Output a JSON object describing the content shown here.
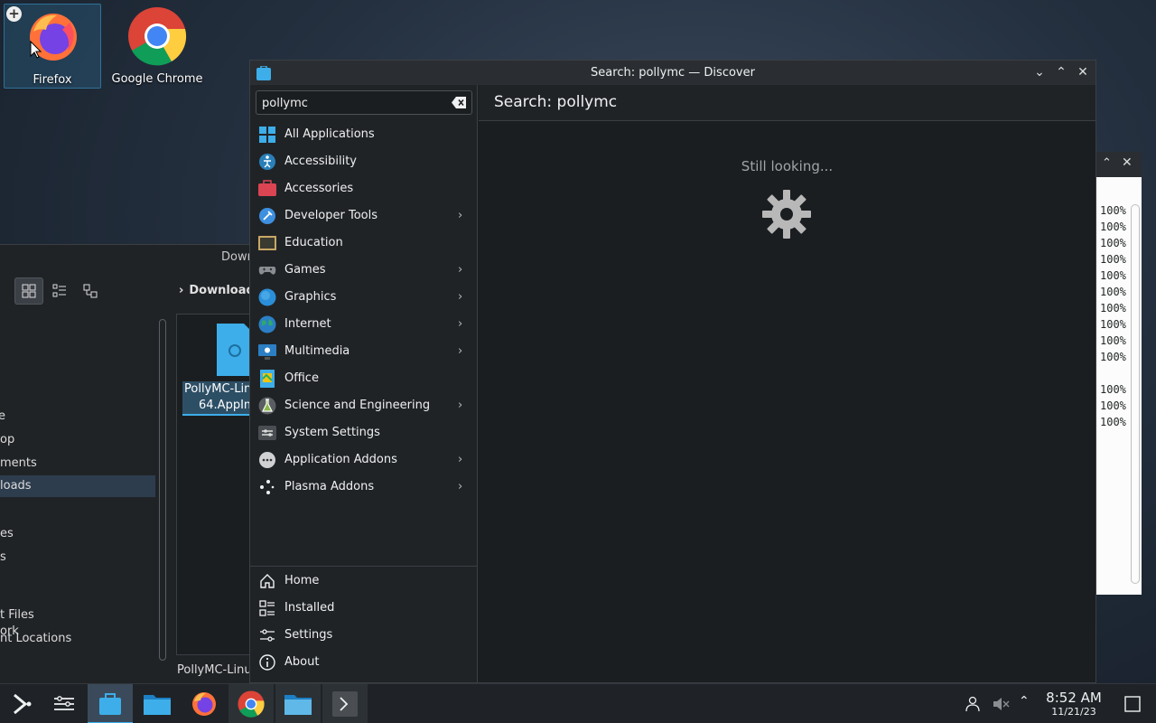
{
  "desktop": {
    "icons": [
      {
        "label": "Firefox",
        "icon": "firefox-icon"
      },
      {
        "label": "Google Chrome",
        "icon": "chrome-icon"
      }
    ]
  },
  "file_manager": {
    "title_partial": "Down",
    "breadcrumb_partial": "Download",
    "places": [
      "e",
      "op",
      "ments",
      "loads",
      "es",
      "s",
      "ork",
      "t Files",
      "nt Locations"
    ],
    "active_place_index": 3,
    "file_label_line1": "PollyMC-Linu",
    "file_label_line2": "64.AppIm",
    "status_partial": "PollyMC-Linu"
  },
  "terminal": {
    "lines": [
      "100%",
      "100%",
      "100%",
      "100%",
      "100%",
      "100%",
      "100%",
      "100%",
      "100%",
      "100%",
      "",
      "100%",
      "100%",
      "100%"
    ]
  },
  "discover": {
    "window_title": "Search: pollymc — Discover",
    "search_value": "pollymc",
    "page_heading": "Search: pollymc",
    "status_text": "Still looking...",
    "categories": [
      {
        "label": "All Applications",
        "icon": "all-apps-icon",
        "color": "#3daee9",
        "has_children": false
      },
      {
        "label": "Accessibility",
        "icon": "accessibility-icon",
        "color": "#2980b9",
        "has_children": false
      },
      {
        "label": "Accessories",
        "icon": "accessories-icon",
        "color": "#da4453",
        "has_children": false
      },
      {
        "label": "Developer Tools",
        "icon": "developer-tools-icon",
        "color": "#3d8fe0",
        "has_children": true
      },
      {
        "label": "Education",
        "icon": "education-icon",
        "color": "#5a5040",
        "has_children": false
      },
      {
        "label": "Games",
        "icon": "games-icon",
        "color": "#8a8e92",
        "has_children": true
      },
      {
        "label": "Graphics",
        "icon": "graphics-icon",
        "color": "#2a8fd8",
        "has_children": true
      },
      {
        "label": "Internet",
        "icon": "internet-icon",
        "color": "#2fa86f",
        "has_children": true
      },
      {
        "label": "Multimedia",
        "icon": "multimedia-icon",
        "color": "#2c7fc4",
        "has_children": true
      },
      {
        "label": "Office",
        "icon": "office-icon",
        "color": "#3daee9",
        "has_children": false
      },
      {
        "label": "Science and Engineering",
        "icon": "science-icon",
        "color": "#8ab84a",
        "has_children": true
      },
      {
        "label": "System Settings",
        "icon": "system-settings-icon",
        "color": "#6a6e72",
        "has_children": false
      },
      {
        "label": "Application Addons",
        "icon": "app-addons-icon",
        "color": "#9a9ea2",
        "has_children": true
      },
      {
        "label": "Plasma Addons",
        "icon": "plasma-addons-icon",
        "color": "#cfd1d3",
        "has_children": true
      }
    ],
    "nav": [
      {
        "label": "Home",
        "icon": "home-icon"
      },
      {
        "label": "Installed",
        "icon": "installed-icon"
      },
      {
        "label": "Settings",
        "icon": "settings-icon"
      },
      {
        "label": "About",
        "icon": "about-icon"
      }
    ]
  },
  "taskbar": {
    "items": [
      "application-launcher-icon",
      "task-manager-icon",
      "discover-icon",
      "file-manager-icon",
      "firefox-icon",
      "chrome-icon",
      "dolphin-icon",
      "konsole-icon"
    ],
    "time": "8:52 AM",
    "date": "11/21/23"
  },
  "colors": {
    "accent": "#3daee9",
    "window_bg": "#1b1e20",
    "sidebar_bg": "#202326"
  }
}
